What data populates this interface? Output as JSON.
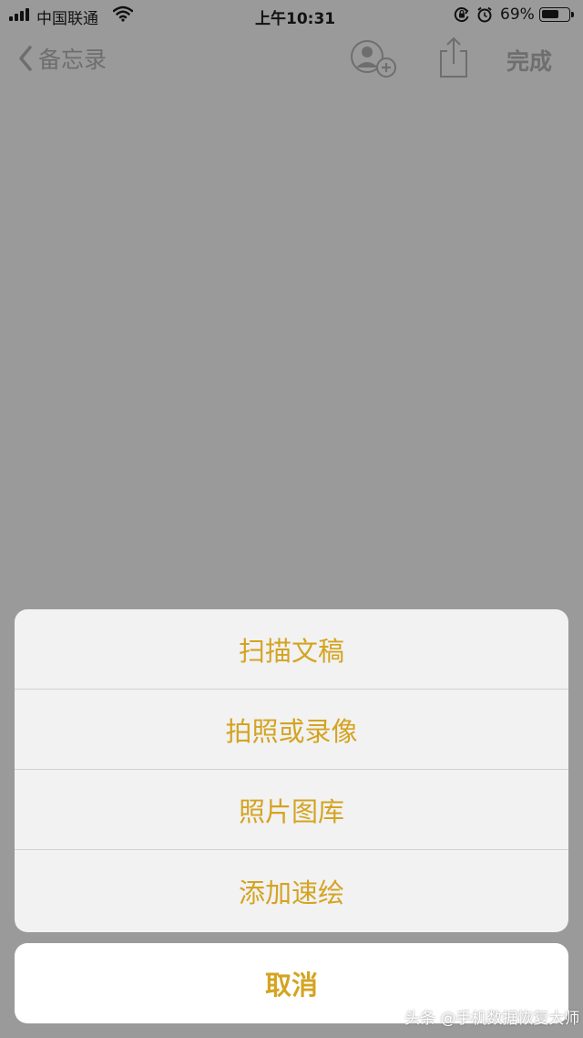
{
  "status_bar": {
    "carrier": "中国联通",
    "time": "上午10:31",
    "battery_percent": "69%",
    "battery_level": 0.69,
    "icons": [
      "signal-icon",
      "wifi-icon",
      "orientation-lock-icon",
      "alarm-icon",
      "battery-icon"
    ]
  },
  "nav": {
    "back_label": "备忘录",
    "done_label": "完成",
    "icons": [
      "chevron-left-icon",
      "add-person-icon",
      "share-icon"
    ],
    "tint_color": "#6e6e6e"
  },
  "action_sheet": {
    "items": [
      {
        "label": "扫描文稿"
      },
      {
        "label": "拍照或录像"
      },
      {
        "label": "照片图库"
      },
      {
        "label": "添加速绘"
      }
    ],
    "cancel_label": "取消",
    "accent_color": "#d4a421"
  },
  "watermark": {
    "text": "头条 @手机数据恢复大师"
  }
}
